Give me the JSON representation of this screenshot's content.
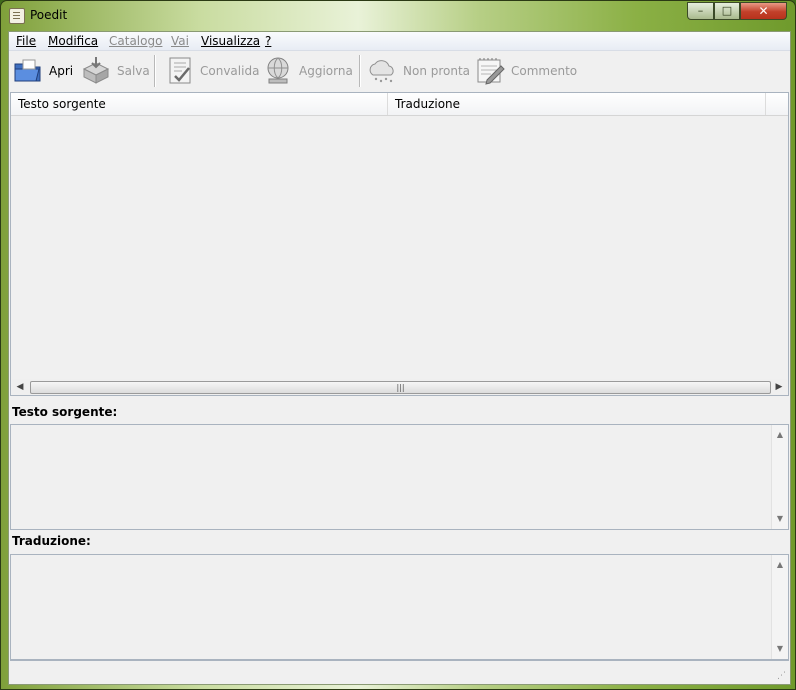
{
  "window": {
    "title": "Poedit",
    "controls": {
      "minimize": "–",
      "maximize": "□",
      "close": "✕"
    }
  },
  "menu": [
    {
      "label": "File",
      "enabled": true
    },
    {
      "label": "Modifica",
      "enabled": true
    },
    {
      "label": "Catalogo",
      "enabled": false
    },
    {
      "label": "Vai",
      "enabled": false
    },
    {
      "label": "Visualizza",
      "enabled": true
    },
    {
      "label": "?",
      "enabled": true
    }
  ],
  "toolbar": {
    "open": {
      "label": "Apri",
      "icon": "folder-open-icon",
      "enabled": true
    },
    "save": {
      "label": "Salva",
      "icon": "save-disk-icon",
      "enabled": false
    },
    "validate": {
      "label": "Convalida",
      "icon": "validate-checklist-icon",
      "enabled": false
    },
    "update": {
      "label": "Aggiorna",
      "icon": "globe-update-icon",
      "enabled": false
    },
    "fuzzy": {
      "label": "Non pronta",
      "icon": "cloud-icon",
      "enabled": false
    },
    "comment": {
      "label": "Commento",
      "icon": "notepad-pen-icon",
      "enabled": false
    }
  },
  "list": {
    "columns": [
      "Testo sorgente",
      "Traduzione"
    ],
    "rows": []
  },
  "source_pane": {
    "label": "Testo sorgente:",
    "value": ""
  },
  "translation_pane": {
    "label": "Traduzione:",
    "value": ""
  },
  "statusbar": {
    "text": ""
  }
}
